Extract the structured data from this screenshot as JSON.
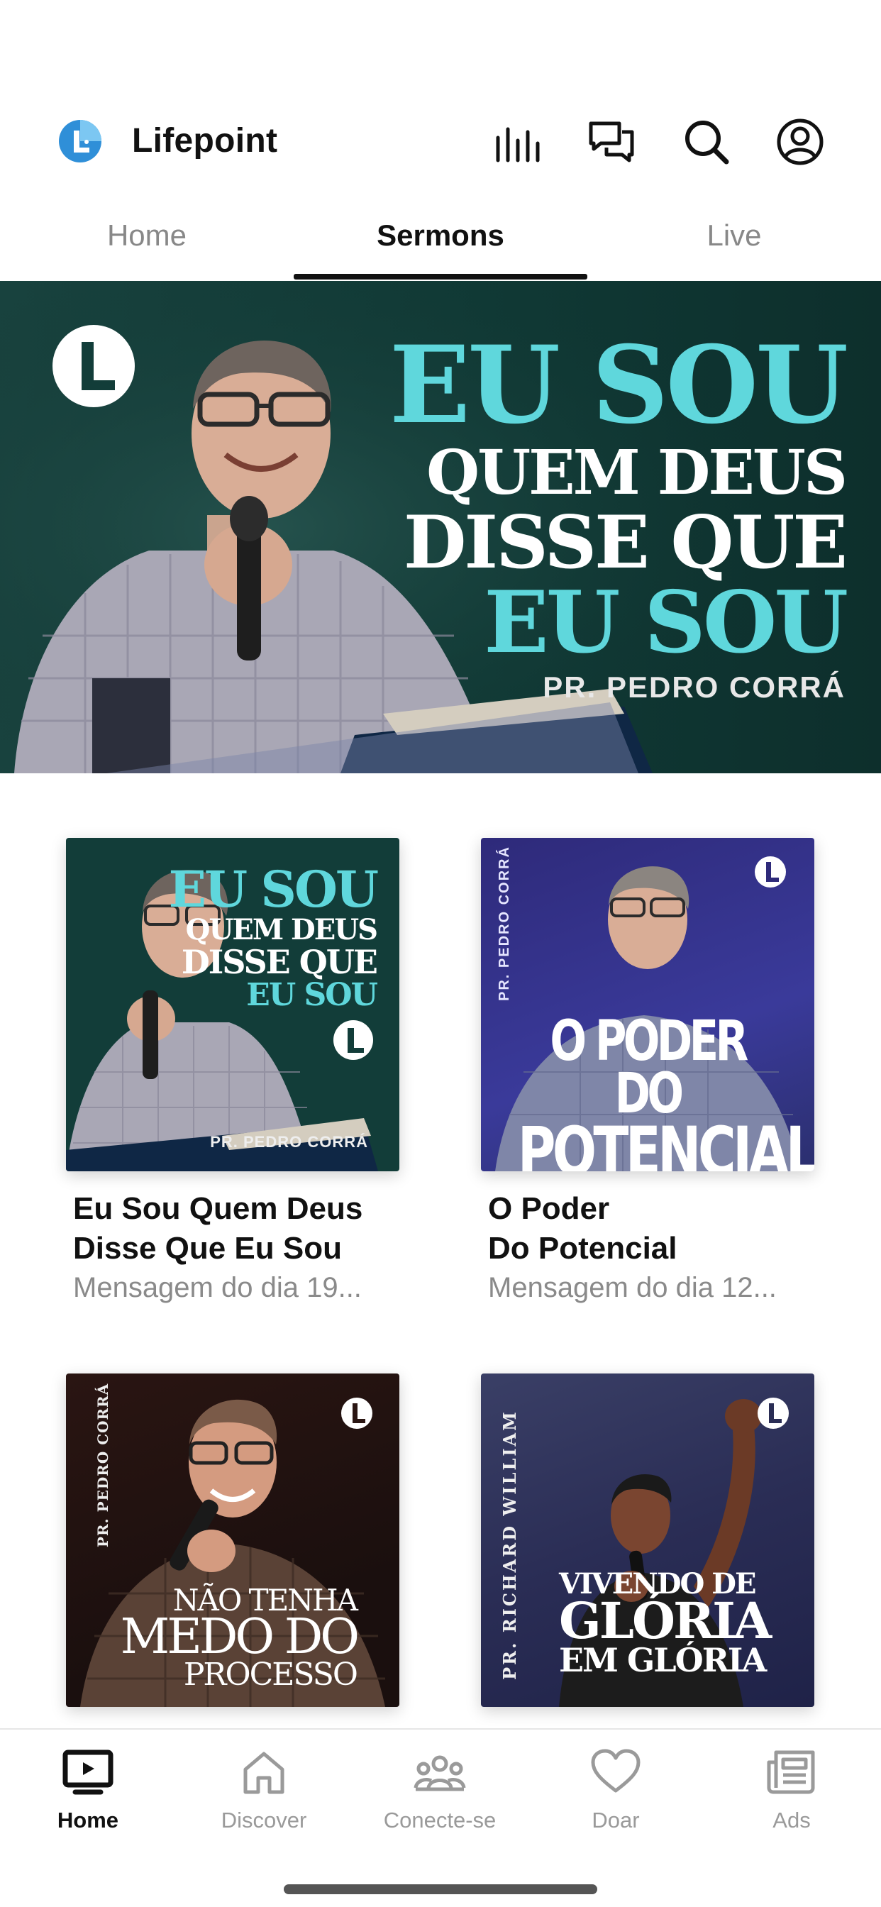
{
  "app": {
    "title": "Lifepoint",
    "accent": "#2f8fd8"
  },
  "header_icons": [
    "stats-icon",
    "chat-icon",
    "search-icon",
    "profile-icon"
  ],
  "tabs": [
    {
      "label": "Home",
      "active": false
    },
    {
      "label": "Sermons",
      "active": true
    },
    {
      "label": "Live",
      "active": false
    }
  ],
  "hero": {
    "line1": "EU SOU",
    "line2": "QUEM DEUS",
    "line3": "DISSE QUE",
    "line4": "EU SOU",
    "speaker": "PR. PEDRO CORRÁ",
    "bg": "#123d39",
    "cyan": "#5fd7dc"
  },
  "cards": [
    {
      "title_line1": "Eu Sou Quem Deus",
      "title_line2": "Disse Que Eu Sou",
      "subtitle": "Mensagem do dia 19...",
      "cover": {
        "l1": "EU SOU",
        "l2": "QUEM DEUS",
        "l3": "DISSE QUE",
        "l4": "EU SOU",
        "speaker": "PR. PEDRO CORRÁ"
      }
    },
    {
      "title_line1": "O Poder",
      "title_line2": "Do Potencial",
      "subtitle": "Mensagem do dia 12...",
      "cover": {
        "l1": "O PODER DO",
        "l2": "POTENCIAL",
        "speaker": "PR. PEDRO CORRÁ"
      }
    },
    {
      "cover": {
        "l1": "NÃO TENHA",
        "l2": "MEDO DO",
        "l3": "PROCESSO",
        "speaker": "PR. PEDRO CORRÁ"
      }
    },
    {
      "cover": {
        "l1": "VIVENDO DE",
        "l2": "GLÓRIA",
        "l3": "EM GLÓRIA",
        "speaker": "PR. RICHARD WILLIAM"
      }
    }
  ],
  "bottom_nav": [
    {
      "label": "Home",
      "icon": "tv-icon",
      "active": true
    },
    {
      "label": "Discover",
      "icon": "house-icon",
      "active": false
    },
    {
      "label": "Conecte-se",
      "icon": "group-icon",
      "active": false
    },
    {
      "label": "Doar",
      "icon": "heart-icon",
      "active": false
    },
    {
      "label": "Ads",
      "icon": "newspaper-icon",
      "active": false
    }
  ]
}
